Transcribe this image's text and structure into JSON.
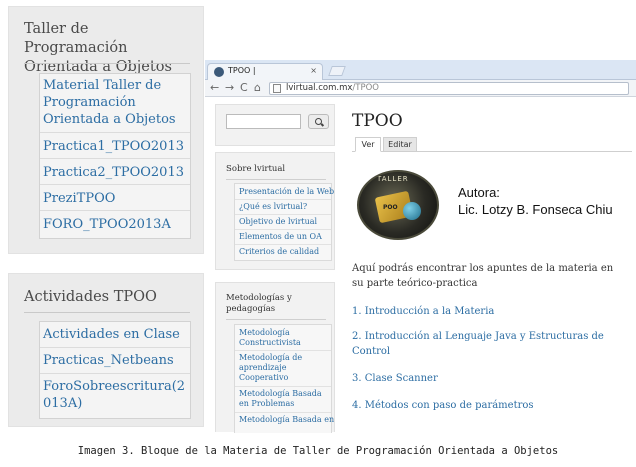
{
  "left_panels": {
    "programming": {
      "title": "Taller de Programación Orientada a Objetos",
      "links": [
        "Material Taller de Programación Orientada a Objetos",
        "Practica1_TPOO2013",
        "Practica2_TPOO2013",
        "PreziTPOO",
        "FORO_TPOO2013A"
      ]
    },
    "activities": {
      "title": "Actividades TPOO",
      "links": [
        "Actividades en Clase",
        "Practicas_Netbeans",
        "ForoSobreescritura(2013A)"
      ]
    }
  },
  "browser": {
    "tab_title": "TPOO |",
    "tab_close": "×",
    "nav": {
      "back": "←",
      "forward": "→",
      "reload": "C",
      "home": "⌂"
    },
    "url_domain": "lvirtual.com.mx",
    "url_path": "/TPOO",
    "search_placeholder": "",
    "sidebar": {
      "about": {
        "title": "Sobre lvirtual",
        "links": [
          "Presentación de la Web",
          "¿Qué es lvirtual?",
          "Objetivo de lvirtual",
          "Elementos de un OA",
          "Criterios de calidad"
        ]
      },
      "methods": {
        "title": "Metodologías y pedagogías",
        "links": [
          "Metodología Constructivista",
          "Metodología de aprendizaje Cooperativo",
          "Metodología Basada en Problemas",
          "Metodología Basada en"
        ]
      }
    },
    "content": {
      "title": "TPOO",
      "tabs": [
        "Ver",
        "Editar"
      ],
      "logo_text": "TALLER",
      "logo_sub": "POO",
      "author_label": "Autora:",
      "author_name": "Lic. Lotzy B. Fonseca Chiu",
      "intro": "Aquí podrás encontrar los apuntes de la materia en su parte teórico-practica",
      "links": [
        "1. Introducción a la Materia",
        "2. Introducción al Lenguaje Java y Estructuras de Control",
        "3. Clase Scanner",
        "4. Métodos con paso de parámetros"
      ]
    }
  },
  "caption": "Imagen 3. Bloque de la Materia de Taller de Programación Orientada a Objetos"
}
